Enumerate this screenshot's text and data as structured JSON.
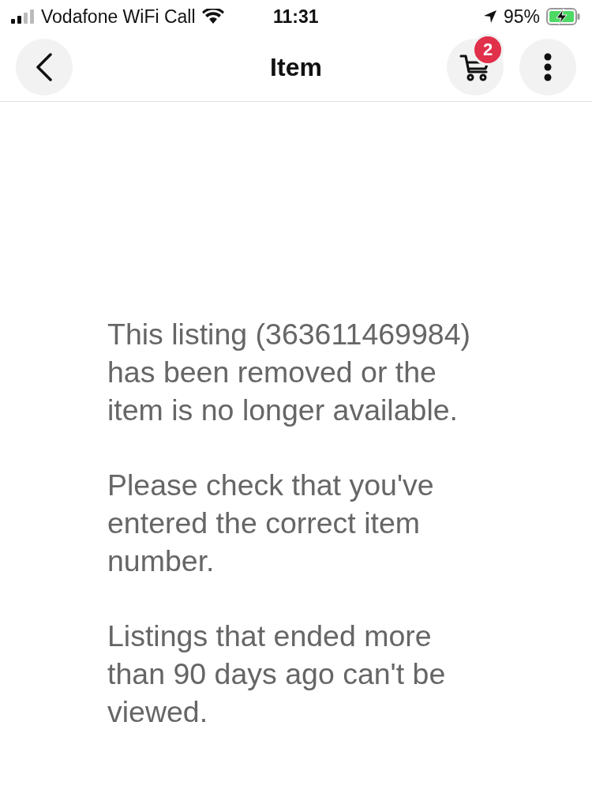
{
  "status_bar": {
    "carrier": "Vodafone WiFi Call",
    "time": "11:31",
    "battery": "95%"
  },
  "header": {
    "title": "Item",
    "cart_count": "2"
  },
  "message": [
    "This listing (363611469984) has been removed or the item is no longer available.",
    "Please check that you've entered the correct item number.",
    "Listings that ended more than 90 days ago can't be viewed."
  ]
}
